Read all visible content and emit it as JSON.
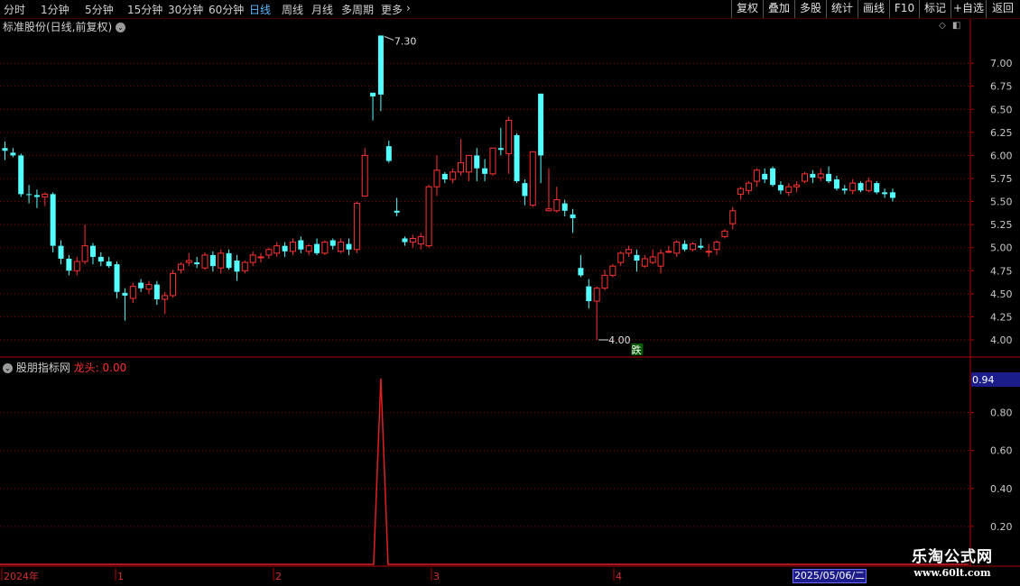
{
  "toolbar": {
    "periods": [
      "分时",
      "1分钟",
      "5分钟",
      "15分钟",
      "30分钟",
      "60分钟",
      "日线",
      "周线",
      "月线",
      "多周期",
      "更多"
    ],
    "active_period": "日线",
    "right_buttons": [
      "复权",
      "叠加",
      "多股",
      "统计",
      "画线",
      "F10",
      "标记",
      "+自选",
      "返回"
    ]
  },
  "main_chart": {
    "title": "标准股份(日线,前复权)",
    "high_label": "7.30",
    "low_label": "4.00",
    "event_badge": "跌",
    "ohlc": [
      [
        6.08,
        6.15,
        5.95,
        6.05
      ],
      [
        6.03,
        6.08,
        5.98,
        6.0
      ],
      [
        6.0,
        6.02,
        5.55,
        5.58
      ],
      [
        5.58,
        5.68,
        5.48,
        5.57
      ],
      [
        5.57,
        5.63,
        5.43,
        5.55
      ],
      [
        5.55,
        5.6,
        5.45,
        5.58
      ],
      [
        5.58,
        5.6,
        4.95,
        5.02
      ],
      [
        5.02,
        5.08,
        4.82,
        4.88
      ],
      [
        4.88,
        4.92,
        4.7,
        4.75
      ],
      [
        4.75,
        4.9,
        4.7,
        4.85
      ],
      [
        4.85,
        5.25,
        4.82,
        5.02
      ],
      [
        5.02,
        5.05,
        4.82,
        4.9
      ],
      [
        4.9,
        4.95,
        4.8,
        4.85
      ],
      [
        4.85,
        4.9,
        4.78,
        4.8
      ],
      [
        4.82,
        4.85,
        4.45,
        4.52
      ],
      [
        4.51,
        4.56,
        4.21,
        4.48
      ],
      [
        4.45,
        4.62,
        4.4,
        4.58
      ],
      [
        4.62,
        4.66,
        4.52,
        4.56
      ],
      [
        4.55,
        4.64,
        4.5,
        4.6
      ],
      [
        4.6,
        4.64,
        4.38,
        4.44
      ],
      [
        4.44,
        4.52,
        4.28,
        4.48
      ],
      [
        4.48,
        4.76,
        4.46,
        4.72
      ],
      [
        4.76,
        4.84,
        4.72,
        4.82
      ],
      [
        4.84,
        4.94,
        4.8,
        4.86
      ],
      [
        4.84,
        4.9,
        4.78,
        4.82
      ],
      [
        4.78,
        4.95,
        4.76,
        4.92
      ],
      [
        4.92,
        4.96,
        4.74,
        4.8
      ],
      [
        4.78,
        4.98,
        4.72,
        4.94
      ],
      [
        4.94,
        4.98,
        4.76,
        4.78
      ],
      [
        4.86,
        4.92,
        4.64,
        4.74
      ],
      [
        4.75,
        4.86,
        4.72,
        4.84
      ],
      [
        4.84,
        4.96,
        4.8,
        4.92
      ],
      [
        4.9,
        4.94,
        4.84,
        4.9
      ],
      [
        4.92,
        5.0,
        4.88,
        4.98
      ],
      [
        4.94,
        5.06,
        4.9,
        5.02
      ],
      [
        5.02,
        5.06,
        4.9,
        4.96
      ],
      [
        4.96,
        5.1,
        4.92,
        5.06
      ],
      [
        5.08,
        5.12,
        4.94,
        4.98
      ],
      [
        4.96,
        5.04,
        4.92,
        5.02
      ],
      [
        5.04,
        5.1,
        4.92,
        4.94
      ],
      [
        4.94,
        5.08,
        4.92,
        5.06
      ],
      [
        5.08,
        5.1,
        4.98,
        5.02
      ],
      [
        4.96,
        5.1,
        4.94,
        5.06
      ],
      [
        5.04,
        5.1,
        4.92,
        4.98
      ],
      [
        4.98,
        5.5,
        4.94,
        5.48
      ],
      [
        5.56,
        6.08,
        5.58,
        6.0
      ],
      [
        6.68,
        6.68,
        6.38,
        6.64
      ],
      [
        7.3,
        7.3,
        6.48,
        6.66
      ],
      [
        6.1,
        6.16,
        5.92,
        5.94
      ],
      [
        5.4,
        5.54,
        5.34,
        5.38
      ],
      [
        5.1,
        5.12,
        5.02,
        5.06
      ],
      [
        5.06,
        5.14,
        5.0,
        5.1
      ],
      [
        5.04,
        5.16,
        4.98,
        5.12
      ],
      [
        5.02,
        5.68,
        5.0,
        5.66
      ],
      [
        5.66,
        6.0,
        5.56,
        5.84
      ],
      [
        5.8,
        5.82,
        5.7,
        5.74
      ],
      [
        5.74,
        5.86,
        5.7,
        5.82
      ],
      [
        5.82,
        6.18,
        5.78,
        5.92
      ],
      [
        5.82,
        6.0,
        5.72,
        6.0
      ],
      [
        6.0,
        6.08,
        5.72,
        5.86
      ],
      [
        5.86,
        5.96,
        5.72,
        5.8
      ],
      [
        5.8,
        6.02,
        5.78,
        6.08
      ],
      [
        6.08,
        6.3,
        6.0,
        6.06
      ],
      [
        6.02,
        6.42,
        5.8,
        6.38
      ],
      [
        6.22,
        6.24,
        5.7,
        5.72
      ],
      [
        5.7,
        5.74,
        5.46,
        5.56
      ],
      [
        5.46,
        6.04,
        5.44,
        6.04
      ],
      [
        6.67,
        6.67,
        5.7,
        6.0
      ],
      [
        5.4,
        5.86,
        5.4,
        5.42
      ],
      [
        5.4,
        5.66,
        5.38,
        5.52
      ],
      [
        5.48,
        5.52,
        5.34,
        5.4
      ],
      [
        5.36,
        5.42,
        5.16,
        5.32
      ],
      [
        4.78,
        4.92,
        4.68,
        4.7
      ],
      [
        4.58,
        4.66,
        4.34,
        4.42
      ],
      [
        4.42,
        4.58,
        4.0,
        4.56
      ],
      [
        4.56,
        4.76,
        4.54,
        4.7
      ],
      [
        4.7,
        4.82,
        4.68,
        4.8
      ],
      [
        4.84,
        4.96,
        4.8,
        4.94
      ],
      [
        4.94,
        5.02,
        4.9,
        4.98
      ],
      [
        4.92,
        4.98,
        4.74,
        4.86
      ],
      [
        4.8,
        4.92,
        4.78,
        4.88
      ],
      [
        4.84,
        4.98,
        4.82,
        4.9
      ],
      [
        4.8,
        4.98,
        4.72,
        4.94
      ],
      [
        4.96,
        5.02,
        4.94,
        4.96
      ],
      [
        4.94,
        5.08,
        4.9,
        5.06
      ],
      [
        5.04,
        5.08,
        4.96,
        4.98
      ],
      [
        4.98,
        5.06,
        4.96,
        5.04
      ],
      [
        5.02,
        5.1,
        4.98,
        5.0
      ],
      [
        4.96,
        5.04,
        4.9,
        4.96
      ],
      [
        4.98,
        5.08,
        4.92,
        5.06
      ],
      [
        5.12,
        5.2,
        5.1,
        5.18
      ],
      [
        5.26,
        5.44,
        5.2,
        5.4
      ],
      [
        5.58,
        5.66,
        5.52,
        5.64
      ],
      [
        5.62,
        5.72,
        5.58,
        5.7
      ],
      [
        5.72,
        5.86,
        5.66,
        5.84
      ],
      [
        5.8,
        5.86,
        5.7,
        5.74
      ],
      [
        5.86,
        5.88,
        5.66,
        5.68
      ],
      [
        5.68,
        5.72,
        5.58,
        5.62
      ],
      [
        5.6,
        5.7,
        5.56,
        5.66
      ],
      [
        5.66,
        5.72,
        5.6,
        5.68
      ],
      [
        5.72,
        5.82,
        5.7,
        5.8
      ],
      [
        5.8,
        5.84,
        5.7,
        5.76
      ],
      [
        5.76,
        5.86,
        5.72,
        5.8
      ],
      [
        5.8,
        5.88,
        5.7,
        5.72
      ],
      [
        5.74,
        5.78,
        5.62,
        5.64
      ],
      [
        5.64,
        5.68,
        5.58,
        5.62
      ],
      [
        5.62,
        5.74,
        5.58,
        5.7
      ],
      [
        5.7,
        5.72,
        5.6,
        5.62
      ],
      [
        5.62,
        5.76,
        5.6,
        5.72
      ],
      [
        5.7,
        5.72,
        5.58,
        5.6
      ],
      [
        5.6,
        5.64,
        5.54,
        5.58
      ],
      [
        5.6,
        5.64,
        5.5,
        5.54
      ]
    ]
  },
  "indicator": {
    "title": "股朋指标网",
    "value_label": "龙头: 0.00",
    "current_value": "0.94",
    "spike_index": 47,
    "spike_value": 0.98
  },
  "axis": {
    "main_ticks": [
      "7.00",
      "6.75",
      "6.50",
      "6.25",
      "6.00",
      "5.75",
      "5.50",
      "5.25",
      "5.00",
      "4.75",
      "4.50",
      "4.25",
      "4.00"
    ],
    "ind_ticks": [
      "0.80",
      "0.60",
      "0.40",
      "0.20"
    ],
    "time_labels": [
      "2024年",
      "1",
      "2",
      "3",
      "4"
    ]
  },
  "footer": {
    "cursor_date": "2025/05/06/二"
  },
  "watermark": {
    "cn": "乐淘公式网",
    "url": "www.60lt.com"
  },
  "colors": {
    "up": "#ff3232",
    "down": "#54ffff",
    "grid": "#8a0000",
    "axis_text": "#c8c8c8",
    "indicator_line": "#e02020"
  }
}
